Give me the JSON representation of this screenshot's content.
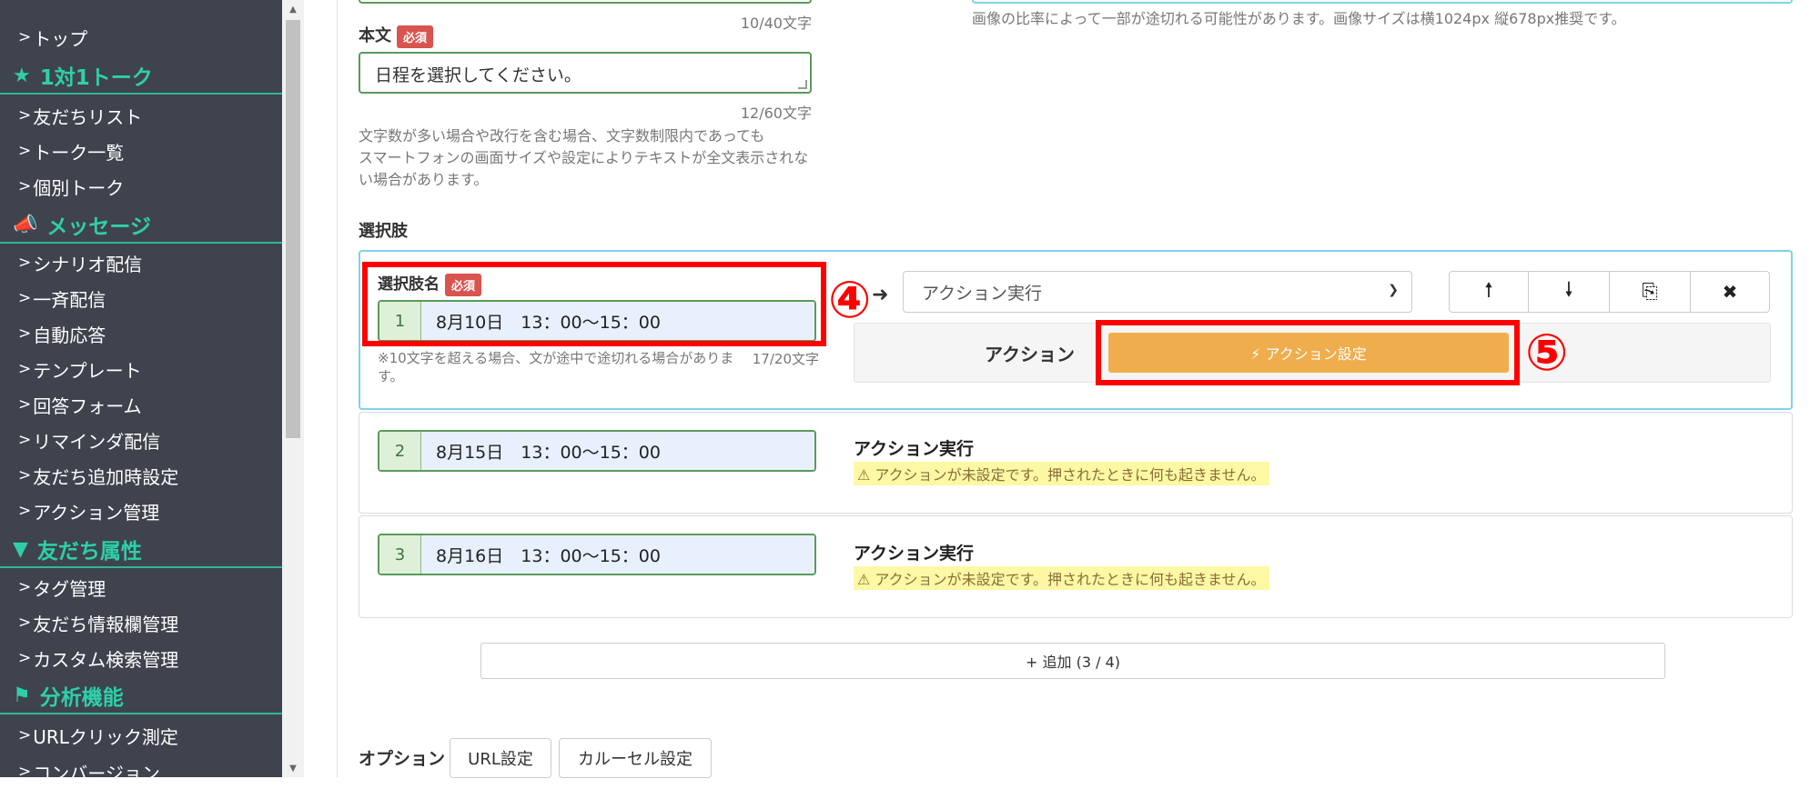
{
  "sidebar": {
    "items": [
      {
        "type": "item",
        "label": "トップ"
      },
      {
        "type": "head",
        "icon": "★",
        "icon_name": "star-icon",
        "label": "1対1トーク"
      },
      {
        "type": "item",
        "label": "友だちリスト"
      },
      {
        "type": "item",
        "label": "トーク一覧"
      },
      {
        "type": "item",
        "label": "個別トーク"
      },
      {
        "type": "head",
        "icon": "📣",
        "icon_name": "megaphone-icon",
        "label": "メッセージ"
      },
      {
        "type": "item",
        "label": "シナリオ配信"
      },
      {
        "type": "item",
        "label": "一斉配信"
      },
      {
        "type": "item",
        "label": "自動応答"
      },
      {
        "type": "item",
        "label": "テンプレート"
      },
      {
        "type": "item",
        "label": "回答フォーム"
      },
      {
        "type": "item",
        "label": "リマインダ配信"
      },
      {
        "type": "item",
        "label": "友だち追加時設定"
      },
      {
        "type": "item",
        "label": "アクション管理"
      },
      {
        "type": "head",
        "icon": "▼",
        "icon_name": "filter-icon",
        "label": "友だち属性"
      },
      {
        "type": "item",
        "label": "タグ管理"
      },
      {
        "type": "item",
        "label": "友だち情報欄管理"
      },
      {
        "type": "item",
        "label": "カスタム検索管理"
      },
      {
        "type": "head",
        "icon": "⚑",
        "icon_name": "flag-icon",
        "label": "分析機能"
      },
      {
        "type": "item",
        "label": "URLクリック測定"
      },
      {
        "type": "item",
        "label": "コンバージョン"
      }
    ]
  },
  "form": {
    "title_count": "10/40文字",
    "image_note": "画像の比率によって一部が途切れる可能性があります。画像サイズは横1024px 縦678px推奨です。",
    "body_label": "本文",
    "required": "必須",
    "body_value": "日程を選択してください。",
    "body_count": "12/60文字",
    "body_help": [
      "文字数が多い場合や改行を含む場合、文字数制限内であっても",
      "スマートフォンの画面サイズや設定によりテキストが全文表示されな",
      "い場合があります。"
    ],
    "choices_label": "選択肢"
  },
  "choices": {
    "name_label": "選択肢名",
    "name_help": "※10文字を超える場合、文が途中で途切れる場合があります。",
    "name_count": "17/20文字",
    "action_select": "アクション実行",
    "action_label": "アクション",
    "action_button": "⚡ アクション設定",
    "items": [
      {
        "num": "1",
        "value": "8月10日　13：00〜15：00"
      },
      {
        "num": "2",
        "value": "8月15日　13：00〜15：00",
        "action_title": "アクション実行",
        "warning": "⚠ アクションが未設定です。押されたときに何も起きません。"
      },
      {
        "num": "3",
        "value": "8月16日　13：00〜15：00",
        "action_title": "アクション実行",
        "warning": "⚠ アクションが未設定です。押されたときに何も起きません。"
      }
    ],
    "buttons": {
      "up": "🠕",
      "down": "🠗",
      "copy": "⎘",
      "delete": "✖"
    },
    "add_button": "+ 追加 (3 / 4)"
  },
  "annotations": {
    "four": "④",
    "five": "⑤"
  },
  "options": {
    "label": "オプション",
    "url_button": "URL設定",
    "carousel_button": "カルーセル設定"
  },
  "colors": {
    "sidebar_bg": "#3f434e",
    "accent": "#2ecfa8",
    "orange": "#f0ad4e",
    "highlight_red": "#ff0000"
  }
}
